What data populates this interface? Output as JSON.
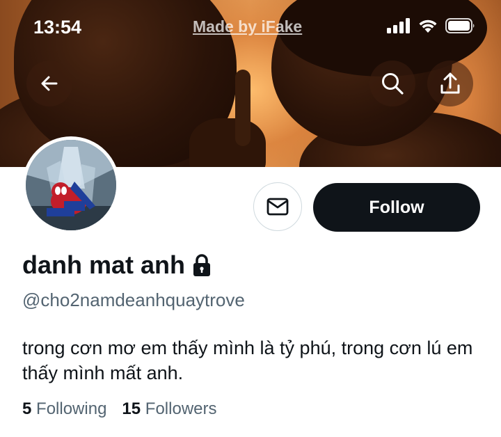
{
  "status_bar": {
    "time": "13:54",
    "watermark": "Made by iFake",
    "icons": [
      "signal-icon",
      "wifi-icon",
      "battery-icon"
    ]
  },
  "header": {
    "back_icon": "back-arrow-icon",
    "search_icon": "search-icon",
    "share_icon": "share-icon"
  },
  "profile": {
    "display_name": "danh mat anh",
    "protected_icon": "lock-icon",
    "handle": "@cho2namdeanhquaytrove",
    "bio": "trong cơn mơ em thấy mình là tỷ phú, trong cơn lú em thấy mình mất anh.",
    "following_count": "5",
    "following_label": "Following",
    "followers_count": "15",
    "followers_label": "Followers"
  },
  "actions": {
    "message_icon": "mail-icon",
    "follow_label": "Follow"
  },
  "colors": {
    "primary_text": "#0f1419",
    "secondary_text": "#536471",
    "follow_button_bg": "#0f1419",
    "border": "#cfd9de"
  }
}
